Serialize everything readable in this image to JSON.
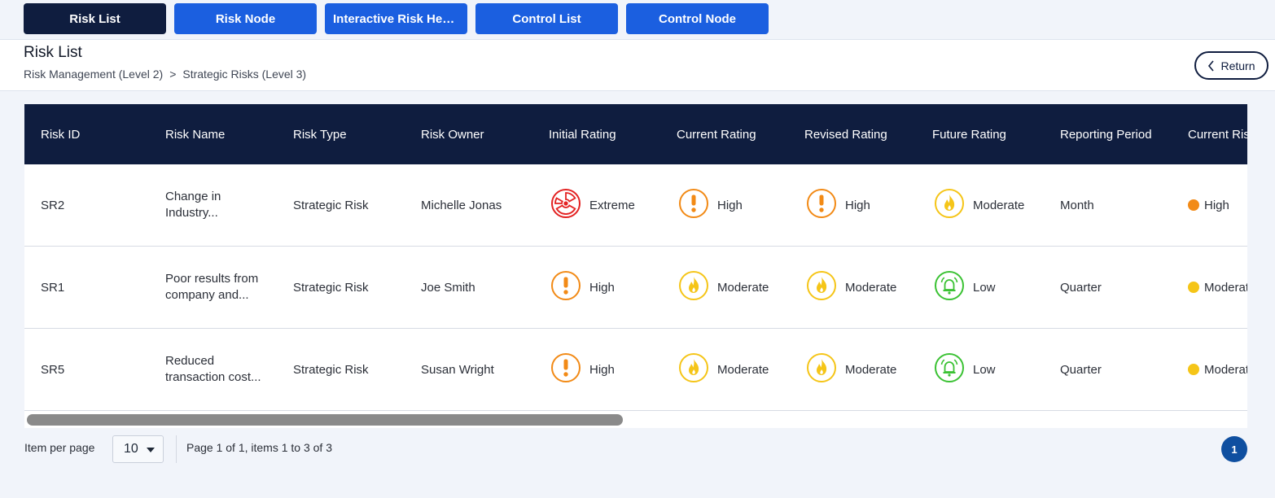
{
  "tabs": [
    {
      "label": "Risk List",
      "active": true
    },
    {
      "label": "Risk Node",
      "active": false
    },
    {
      "label": "Interactive Risk Hea...",
      "active": false
    },
    {
      "label": "Control List",
      "active": false
    },
    {
      "label": "Control Node",
      "active": false
    }
  ],
  "header": {
    "title": "Risk List",
    "breadcrumb": [
      "Risk Management (Level 2)",
      ">",
      "Strategic Risks (Level 3)"
    ],
    "return_label": "Return"
  },
  "table": {
    "columns": [
      "Risk ID",
      "Risk Name",
      "Risk Type",
      "Risk Owner",
      "Initial Rating",
      "Current Rating",
      "Revised Rating",
      "Future Rating",
      "Reporting Period",
      "Current Ris"
    ],
    "rows": [
      {
        "id": "SR2",
        "name_line1": "Change in",
        "name_line2": "Industry...",
        "type": "Strategic Risk",
        "owner": "Michelle Jonas",
        "initial": {
          "label": "Extreme",
          "icon": "radiation-icon"
        },
        "current": {
          "label": "High",
          "icon": "exclamation-icon"
        },
        "revised": {
          "label": "High",
          "icon": "exclamation-icon"
        },
        "future": {
          "label": "Moderate",
          "icon": "flame-icon"
        },
        "period": "Month",
        "current_risk": {
          "label": "High",
          "color": "#f28a16"
        }
      },
      {
        "id": "SR1",
        "name_line1": "Poor results from",
        "name_line2": "company and...",
        "type": "Strategic Risk",
        "owner": "Joe Smith",
        "initial": {
          "label": "High",
          "icon": "exclamation-icon"
        },
        "current": {
          "label": "Moderate",
          "icon": "flame-icon"
        },
        "revised": {
          "label": "Moderate",
          "icon": "flame-icon"
        },
        "future": {
          "label": "Low",
          "icon": "bell-icon"
        },
        "period": "Quarter",
        "current_risk": {
          "label": "Moderate",
          "color": "#f5c518"
        }
      },
      {
        "id": "SR5",
        "name_line1": "Reduced",
        "name_line2": "transaction cost...",
        "type": "Strategic Risk",
        "owner": "Susan Wright",
        "initial": {
          "label": "High",
          "icon": "exclamation-icon"
        },
        "current": {
          "label": "Moderate",
          "icon": "flame-icon"
        },
        "revised": {
          "label": "Moderate",
          "icon": "flame-icon"
        },
        "future": {
          "label": "Low",
          "icon": "bell-icon"
        },
        "period": "Quarter",
        "current_risk": {
          "label": "Moderate",
          "color": "#f5c518"
        }
      }
    ]
  },
  "pager": {
    "items_label": "Item per page",
    "page_size": "10",
    "info": "Page 1 of 1, items 1 to 3 of 3",
    "current_page": "1"
  },
  "colors": {
    "extreme": "#e32222",
    "high": "#f28a16",
    "moderate": "#f5c518",
    "low": "#3bc234",
    "navy": "#0f1d3f",
    "tab_blue": "#1b5fe0"
  }
}
